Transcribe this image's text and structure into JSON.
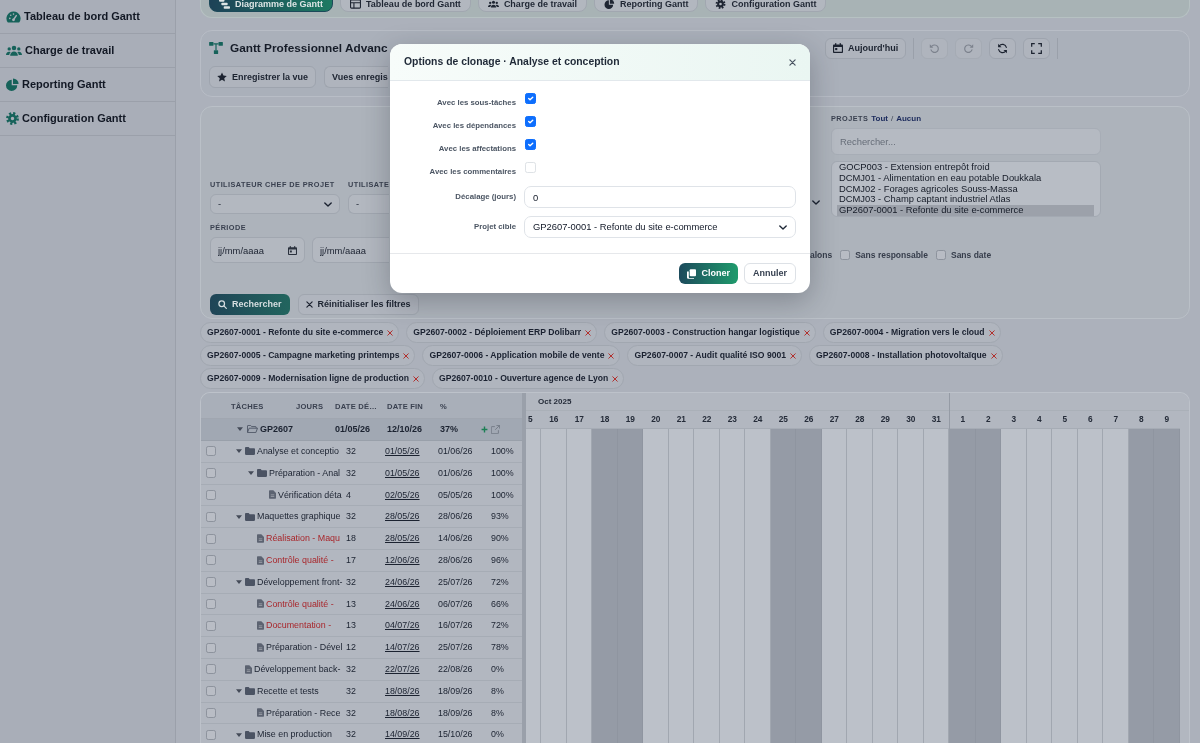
{
  "sidebar": {
    "items": [
      "Tableau de bord Gantt",
      "Charge de travail",
      "Reporting Gantt",
      "Configuration Gantt"
    ]
  },
  "tabs": [
    {
      "label": "Diagramme de Gantt",
      "selected": true
    },
    {
      "label": "Tableau de bord Gantt",
      "selected": false
    },
    {
      "label": "Charge de travail",
      "selected": false
    },
    {
      "label": "Reporting Gantt",
      "selected": false
    },
    {
      "label": "Configuration Gantt",
      "selected": false
    }
  ],
  "toolbar": {
    "title": "Gantt Professionnel Advanc",
    "today_button": "Aujourd'hui",
    "icon_buttons": [
      {
        "disabled": true
      },
      {
        "disabled": true
      },
      {
        "disabled": false
      },
      {
        "disabled": false
      }
    ],
    "save_view_button": "Enregistrer la vue",
    "saved_views_button": "Vues enregis"
  },
  "filters": {
    "fields": [
      {
        "label": "UTILISATEUR CHEF DE PROJET",
        "value": "-"
      },
      {
        "label": "UTILISATE",
        "value": "-"
      }
    ],
    "period": {
      "label": "PÉRIODE",
      "from_placeholder": "jj/mm/aaaa",
      "to_placeholder": "jj/mm/aaaa"
    },
    "projects": {
      "label": "PROJETS",
      "all_link": "Tout",
      "separator": "/",
      "none_link": "Aucun",
      "search_placeholder": "Rechercher...",
      "options": [
        {
          "label": "GOCP003 - Extension entrepôt froid",
          "selected": false
        },
        {
          "label": "DCMJ01 - Alimentation en eau potable Doukkala",
          "selected": false
        },
        {
          "label": "DCMJ02 - Forages agricoles Souss-Massa",
          "selected": false
        },
        {
          "label": "DCMJ03 - Champ captant industriel Atlas",
          "selected": false
        },
        {
          "label": "GP2607-0001 - Refonte du site e-commerce",
          "selected": true
        }
      ]
    },
    "partial_label": "alons",
    "checkboxes": [
      {
        "label": "Sans responsable",
        "checked": false
      },
      {
        "label": "Sans date",
        "checked": false
      }
    ],
    "search_button": "Rechercher",
    "reset_button": "Réinitialiser les filtres"
  },
  "project_chips": [
    "GP2607-0001 - Refonte du site e-commerce",
    "GP2607-0002 - Déploiement ERP Dolibarr",
    "GP2607-0003 - Construction hangar logistique",
    "GP2607-0004 - Migration vers le cloud",
    "GP2607-0005 - Campagne marketing printemps",
    "GP2607-0006 - Application mobile de vente",
    "GP2607-0007 - Audit qualité ISO 9001",
    "GP2607-0008 - Installation photovoltaïque",
    "GP2607-0009 - Modernisation ligne de production",
    "GP2607-0010 - Ouverture agence de Lyon"
  ],
  "gantt": {
    "columns": [
      "TÂCHES",
      "JOURS",
      "DATE DÉ…",
      "DATE FIN",
      "%"
    ],
    "project_row": {
      "name": "GP2607",
      "start": "01/05/26",
      "end": "12/10/26",
      "progress": "37%",
      "expanded": true
    },
    "tasks": [
      {
        "kind": "folder",
        "name": "Analyse et conceptio",
        "days": "32",
        "start": "01/05/26",
        "end": "01/06/26",
        "progress": "100%",
        "checked": false,
        "late": false,
        "expanded": true,
        "children": [
          {
            "kind": "folder",
            "name": "Préparation - Anal",
            "days": "32",
            "start": "01/05/26",
            "end": "01/06/26",
            "progress": "100%",
            "checked": false,
            "late": false,
            "expanded": true,
            "children": [
              {
                "kind": "task",
                "name": "Vérification déta",
                "days": "4",
                "start": "02/05/26",
                "end": "05/05/26",
                "progress": "100%",
                "checked": false,
                "late": false
              }
            ]
          }
        ]
      },
      {
        "kind": "folder",
        "name": "Maquettes graphique",
        "days": "32",
        "start": "28/05/26",
        "end": "28/06/26",
        "progress": "93%",
        "checked": false,
        "late": false,
        "expanded": true,
        "children": [
          {
            "kind": "task",
            "name": "Réalisation - Maqu",
            "days": "18",
            "start": "28/05/26",
            "end": "14/06/26",
            "progress": "90%",
            "checked": false,
            "late": true
          },
          {
            "kind": "task",
            "name": "Contrôle qualité -",
            "days": "17",
            "start": "12/06/26",
            "end": "28/06/26",
            "progress": "96%",
            "checked": false,
            "late": true
          }
        ]
      },
      {
        "kind": "folder",
        "name": "Développement front-",
        "days": "32",
        "start": "24/06/26",
        "end": "25/07/26",
        "progress": "72%",
        "checked": false,
        "late": false,
        "expanded": true,
        "children": [
          {
            "kind": "task",
            "name": "Contrôle qualité -",
            "days": "13",
            "start": "24/06/26",
            "end": "06/07/26",
            "progress": "66%",
            "checked": false,
            "late": true
          },
          {
            "kind": "task",
            "name": "Documentation -",
            "days": "13",
            "start": "04/07/26",
            "end": "16/07/26",
            "progress": "72%",
            "checked": false,
            "late": true
          },
          {
            "kind": "task",
            "name": "Préparation - Dével",
            "days": "12",
            "start": "14/07/26",
            "end": "25/07/26",
            "progress": "78%",
            "checked": false,
            "late": false
          }
        ]
      },
      {
        "kind": "task",
        "name": "Développement back-",
        "days": "32",
        "start": "22/07/26",
        "end": "22/08/26",
        "progress": "0%",
        "checked": false,
        "late": false
      },
      {
        "kind": "folder",
        "name": "Recette et tests",
        "days": "32",
        "start": "18/08/26",
        "end": "18/09/26",
        "progress": "8%",
        "checked": false,
        "late": false,
        "expanded": true,
        "children": [
          {
            "kind": "task",
            "name": "Préparation - Rece",
            "days": "32",
            "start": "18/08/26",
            "end": "18/09/26",
            "progress": "8%",
            "checked": false,
            "late": false
          }
        ]
      },
      {
        "kind": "folder",
        "name": "Mise en production",
        "days": "32",
        "start": "14/09/26",
        "end": "15/10/26",
        "progress": "0%",
        "checked": false,
        "late": false,
        "expanded": true
      }
    ],
    "timeline": {
      "months": [
        {
          "label": "Oct 2025",
          "days": [
            {
              "label": "5",
              "weekend": false
            },
            {
              "label": "16",
              "weekend": false
            },
            {
              "label": "17",
              "weekend": false
            },
            {
              "label": "18",
              "weekend": true
            },
            {
              "label": "19",
              "weekend": true
            },
            {
              "label": "20",
              "weekend": false
            },
            {
              "label": "21",
              "weekend": false
            },
            {
              "label": "22",
              "weekend": false
            },
            {
              "label": "23",
              "weekend": false
            },
            {
              "label": "24",
              "weekend": false
            },
            {
              "label": "25",
              "weekend": true
            },
            {
              "label": "26",
              "weekend": true
            },
            {
              "label": "27",
              "weekend": false
            },
            {
              "label": "28",
              "weekend": false
            },
            {
              "label": "29",
              "weekend": false
            },
            {
              "label": "30",
              "weekend": false
            },
            {
              "label": "31",
              "weekend": false
            }
          ]
        },
        {
          "days": [
            {
              "label": "1",
              "weekend": true
            },
            {
              "label": "2",
              "weekend": true
            },
            {
              "label": "3",
              "weekend": false
            },
            {
              "label": "4",
              "weekend": false
            },
            {
              "label": "5",
              "weekend": false
            },
            {
              "label": "6",
              "weekend": false
            },
            {
              "label": "7",
              "weekend": false
            },
            {
              "label": "8",
              "weekend": true
            },
            {
              "label": "9",
              "weekend": true
            }
          ]
        }
      ]
    }
  },
  "modal": {
    "title": "Options de clonage · Analyse et conception",
    "options": [
      {
        "label": "Avec les sous-tâches",
        "checked": true
      },
      {
        "label": "Avec les dépendances",
        "checked": true
      },
      {
        "label": "Avec les affectations",
        "checked": true
      },
      {
        "label": "Avec les commentaires",
        "checked": false
      }
    ],
    "offset": {
      "label": "Décalage (jours)",
      "value": "0"
    },
    "target": {
      "label": "Projet cible",
      "value": "GP2607-0001 - Refonte du site e-commerce"
    },
    "buttons": [
      {
        "label": "Cloner",
        "kind": "primary"
      },
      {
        "label": "Annuler",
        "kind": "secondary"
      }
    ]
  }
}
